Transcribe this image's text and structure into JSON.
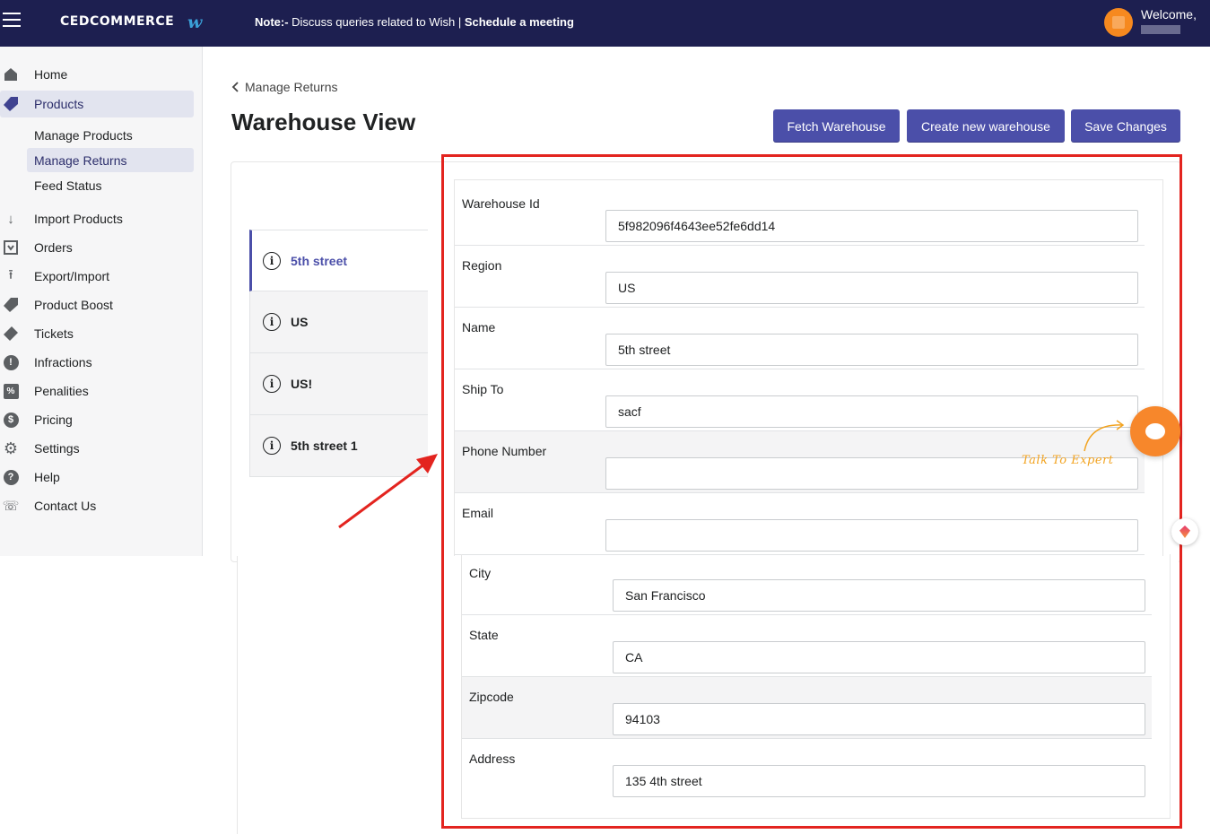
{
  "topbar": {
    "brand": "CEDCOMMERCE",
    "brand_mark": "w",
    "note_label": "Note:-",
    "note_text": " Discuss queries related to Wish | ",
    "note_link": "Schedule a meeting",
    "welcome": "Welcome,"
  },
  "sidebar": {
    "items": [
      {
        "label": "Home",
        "icon": "home-icon"
      },
      {
        "label": "Products",
        "icon": "tag-icon"
      },
      {
        "label": "Import Products",
        "icon": "arrow-down-icon"
      },
      {
        "label": "Orders",
        "icon": "orders-icon"
      },
      {
        "label": "Export/Import",
        "icon": "upload-icon"
      },
      {
        "label": "Product Boost",
        "icon": "tag-icon"
      },
      {
        "label": "Tickets",
        "icon": "ticket-icon"
      },
      {
        "label": "Infractions",
        "icon": "alert-icon"
      },
      {
        "label": "Penalities",
        "icon": "percent-icon"
      },
      {
        "label": "Pricing",
        "icon": "dollar-icon"
      },
      {
        "label": "Settings",
        "icon": "gear-icon"
      },
      {
        "label": "Help",
        "icon": "help-icon"
      },
      {
        "label": "Contact Us",
        "icon": "phone-icon"
      }
    ],
    "subitems": [
      {
        "label": "Manage Products"
      },
      {
        "label": "Manage Returns"
      },
      {
        "label": "Feed Status"
      }
    ]
  },
  "main": {
    "breadcrumb": "Manage Returns",
    "title": "Warehouse View",
    "buttons": {
      "fetch": "Fetch Warehouse",
      "create": "Create new warehouse",
      "save": "Save Changes"
    },
    "tabs": [
      {
        "label": "5th street"
      },
      {
        "label": "US"
      },
      {
        "label": "US!"
      },
      {
        "label": "5th street 1"
      }
    ],
    "fields": [
      {
        "label": "Warehouse Id",
        "value": "5f982096f4643ee52fe6dd14"
      },
      {
        "label": "Region",
        "value": "US"
      },
      {
        "label": "Name",
        "value": "5th street"
      },
      {
        "label": "Ship To",
        "value": "sacf"
      },
      {
        "label": "Phone Number",
        "value": ""
      },
      {
        "label": "Email",
        "value": ""
      },
      {
        "label": "City",
        "value": "San Francisco"
      },
      {
        "label": "State",
        "value": "CA"
      },
      {
        "label": "Zipcode",
        "value": "94103"
      },
      {
        "label": "Address",
        "value": "135 4th street"
      }
    ]
  },
  "widgets": {
    "talk_to_expert": "Talk To Expert"
  },
  "colors": {
    "topbar": "#1d1f50",
    "accent": "#4b4fa9",
    "highlight_box": "#e3241f",
    "chat": "#f7872b"
  }
}
